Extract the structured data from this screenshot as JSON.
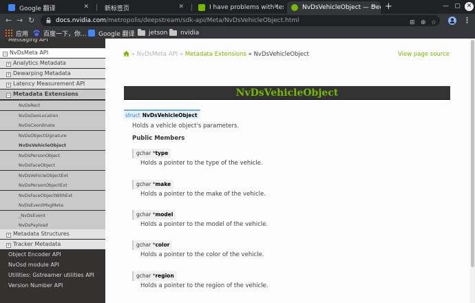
{
  "browser": {
    "tabs": [
      {
        "label": "Google 翻译",
        "active": false
      },
      {
        "label": "新标签页",
        "active": false
      },
      {
        "label": "I have problems with test",
        "active": false
      },
      {
        "label": "NvDsVehicleObject — Dee",
        "active": true
      }
    ],
    "address": {
      "host": "docs.nvidia.com",
      "path": "/metropolis/deepstream/sdk-api/Meta/NvDsVehicleObject.html"
    },
    "bookmarks": [
      "应用",
      "百度一下，你...",
      "Google 翻译",
      "jetson",
      "nvidia"
    ],
    "colors": {
      "brand": "#76b900",
      "sidebar_bg": "#343131"
    }
  },
  "sidebar": {
    "top_item": "Messaging API",
    "current": "NvDsMeta API",
    "sections": [
      {
        "label": "Analytics Metadata",
        "toggle": "+"
      },
      {
        "label": "Dewarping Metadata",
        "toggle": "+"
      },
      {
        "label": "Latency Measurement API",
        "toggle": "+"
      },
      {
        "label": "Metadata Extensions",
        "toggle": "−"
      }
    ],
    "subitems": [
      "NvDsRect",
      "NvDsGeoLocation",
      "NvDsCoordinate",
      "NvDsObjectSignature",
      "NvDsVehicleObject",
      "NvDsPersonObject",
      "NvDsFaceObject",
      "NvDsVehicleObjectExt",
      "NvDsPersonObjectExt",
      "NvDsFaceObjectWithExt",
      "NvDsEventMsgMeta",
      "_NvDsEvent",
      "NvDsPayload"
    ],
    "after_sections": [
      {
        "label": "Metadata Structures",
        "toggle": "+"
      },
      {
        "label": "Tracker Metadata",
        "toggle": "+"
      }
    ],
    "bottom_items": [
      "Object Encoder API",
      "NvOsd module API",
      "Utilities: Gstreamer utilities API",
      "Version Number API"
    ]
  },
  "content": {
    "breadcrumb": {
      "parent": "NvDsMeta API",
      "section": "Metadata Extensions",
      "current": "NvDsVehicleObject"
    },
    "sep": "»",
    "view_source": "View page source",
    "title": "NvDsVehicleObject",
    "struct": {
      "keyword": "struct",
      "name": "NvDsVehicleObject"
    },
    "description": "Holds a vehicle object's parameters.",
    "public_members_label": "Public Members",
    "members": [
      {
        "type": "gchar *",
        "name": "type",
        "desc": "Holds a pointer to the type of the vehicle."
      },
      {
        "type": "gchar *",
        "name": "make",
        "desc": "Holds a pointer to the make of the vehicle."
      },
      {
        "type": "gchar *",
        "name": "model",
        "desc": "Holds a pointer to the model of the vehicle."
      },
      {
        "type": "gchar *",
        "name": "color",
        "desc": "Holds a pointer to the color of the vehicle."
      },
      {
        "type": "gchar *",
        "name": "region",
        "desc": "Holds a pointer to the region of the vehicle."
      }
    ]
  }
}
